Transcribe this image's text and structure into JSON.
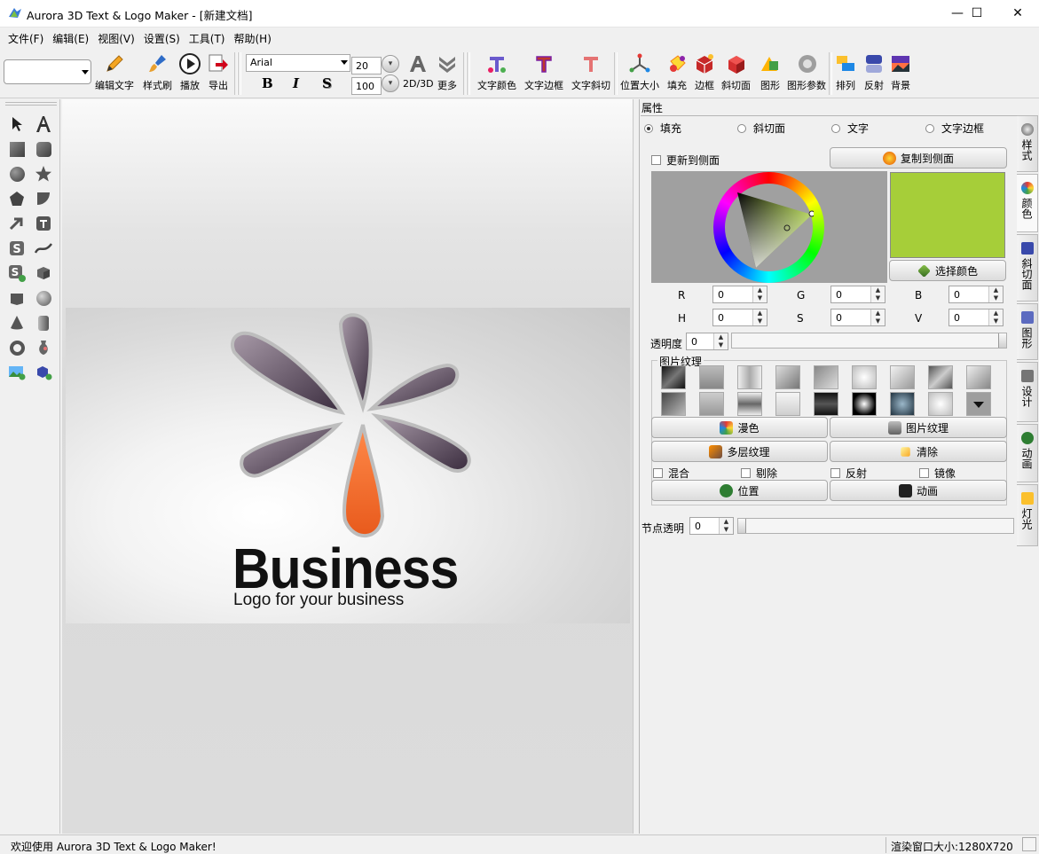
{
  "window": {
    "title": "Aurora 3D Text & Logo Maker - [新建文档]",
    "minimize_glyph": "—",
    "maximize_glyph": "☐",
    "close_glyph": "✕"
  },
  "menu": [
    "文件(F)",
    "编辑(E)",
    "视图(V)",
    "设置(S)",
    "工具(T)",
    "帮助(H)"
  ],
  "toolbar": {
    "edit_text": "编辑文字",
    "style_brush": "样式刷",
    "play": "播放",
    "export": "导出",
    "font_name": "Arial",
    "font_size": "20",
    "font_size2": "100",
    "bold": "B",
    "italic": "I",
    "shadow": "S",
    "mode_2d3d": "2D/3D",
    "more": "更多",
    "text_color": "文字颜色",
    "text_border": "文字边框",
    "text_skew": "文字斜切",
    "pos_size": "位置大小",
    "fill": "填充",
    "border": "边框",
    "bevel": "斜切面",
    "shape": "图形",
    "shape_params": "图形参数",
    "arrange": "排列",
    "reflect": "反射",
    "background": "背景"
  },
  "canvas": {
    "brand_text": "Business",
    "tagline": "Logo for your business",
    "accent_color": "#f26b2f",
    "petal_color": "#5c4a63"
  },
  "props": {
    "title": "属性",
    "tabs": [
      "填充",
      "斜切面",
      "文字",
      "文字边框"
    ],
    "selected_tab": "填充",
    "update_side": "更新到侧面",
    "copy_side": "复制到侧面",
    "pick_color": "选择颜色",
    "current_color": "#a6ce39",
    "r_label": "R",
    "r_value": "0",
    "g_label": "G",
    "g_value": "0",
    "b_label": "B",
    "b_value": "0",
    "h_label": "H",
    "h_value": "0",
    "s_label": "S",
    "s_value": "0",
    "v_label": "V",
    "v_value": "0",
    "opacity_label": "透明度",
    "opacity_value": "0",
    "texture_group": "图片纹理",
    "diffuse": "漫色",
    "image_texture": "图片纹理",
    "multi_texture": "多层纹理",
    "clear": "清除",
    "blend": "混合",
    "cull": "剔除",
    "reflect": "反射",
    "mirror": "镜像",
    "position": "位置",
    "animation": "动画",
    "node_opacity_label": "节点透明",
    "node_opacity_value": "0"
  },
  "vtabs": [
    "样式",
    "颜色",
    "斜切面",
    "图形",
    "设计",
    "动画",
    "灯光"
  ],
  "status": {
    "welcome": "欢迎使用 Aurora 3D Text & Logo Maker!",
    "render_size": "渲染窗口大小:1280X720"
  }
}
